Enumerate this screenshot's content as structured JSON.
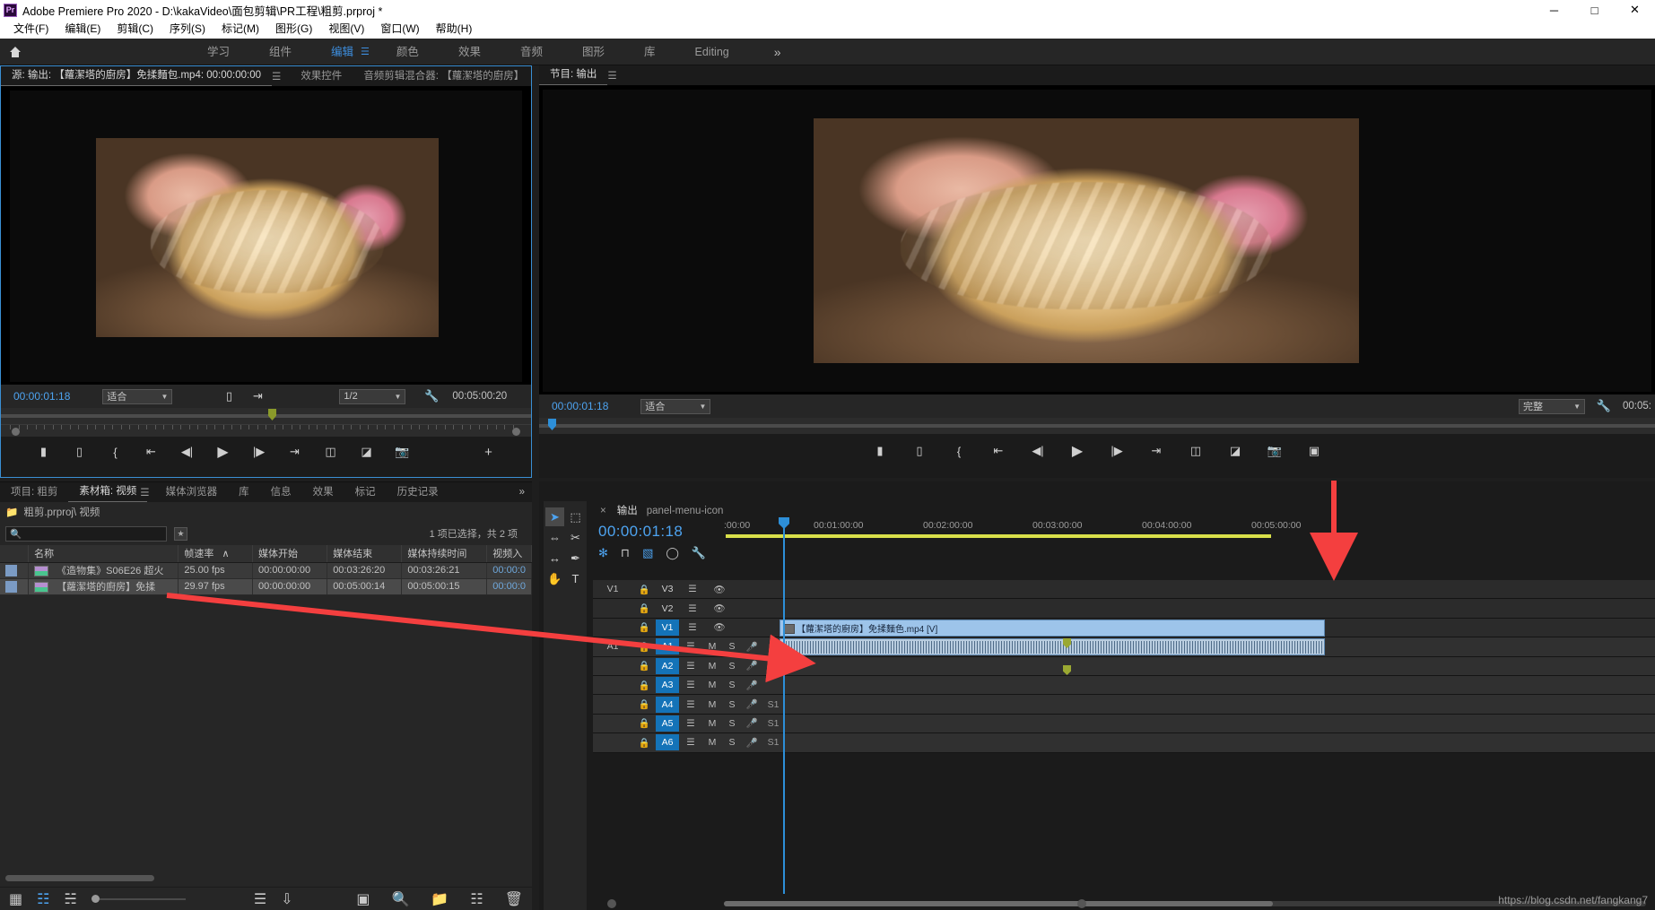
{
  "window": {
    "title": "Adobe Premiere Pro 2020 - D:\\kakaVideo\\面包剪辑\\PR工程\\粗剪.prproj *",
    "logo": "Pr",
    "minimize": "─",
    "maximize": "□",
    "close": "✕"
  },
  "menu": {
    "items": [
      "文件(F)",
      "编辑(E)",
      "剪辑(C)",
      "序列(S)",
      "标记(M)",
      "图形(G)",
      "视图(V)",
      "窗口(W)",
      "帮助(H)"
    ]
  },
  "workspace": {
    "home_icon": "home-icon",
    "tabs": [
      {
        "label": "学习",
        "active": false
      },
      {
        "label": "组件",
        "active": false
      },
      {
        "label": "编辑",
        "active": true
      },
      {
        "label": "颜色",
        "active": false
      },
      {
        "label": "效果",
        "active": false
      },
      {
        "label": "音频",
        "active": false
      },
      {
        "label": "图形",
        "active": false
      },
      {
        "label": "库",
        "active": false
      },
      {
        "label": "Editing",
        "active": false
      }
    ],
    "more": "»"
  },
  "source_monitor": {
    "tabs": [
      {
        "label": "源: 输出: 【蘿潔塔的廚房】免揉麵包.mp4: 00:00:00:00",
        "active": true
      },
      {
        "label": "效果控件",
        "active": false
      },
      {
        "label": "音频剪辑混合器: 【蘿潔塔的廚房】",
        "active": false
      }
    ],
    "overflow": "»",
    "timecode": "00:00:01:18",
    "fit": "适合",
    "resolution": "1/2",
    "duration": "00:05:00:20",
    "buttons": [
      "mark-in-icon",
      "mark-out-icon",
      "go-to-in-icon",
      "step-back-icon",
      "play-icon",
      "step-forward-icon",
      "go-to-out-icon",
      "insert-icon",
      "overwrite-icon",
      "export-frame-icon"
    ],
    "add_button": "+"
  },
  "program_monitor": {
    "tabs": [
      {
        "label": "节目: 输出",
        "active": true
      }
    ],
    "menu_icon": "panel-menu-icon",
    "timecode": "00:00:01:18",
    "fit": "适合",
    "quality": "完整",
    "duration": "00:05:",
    "buttons": [
      "mark-in-icon",
      "mark-out-icon",
      "go-to-in-icon",
      "step-back-icon",
      "play-icon",
      "step-forward-icon",
      "go-to-out-icon",
      "lift-icon",
      "extract-icon",
      "export-frame-icon",
      "comparison-view-icon"
    ]
  },
  "project_panel": {
    "tabs": [
      {
        "label": "项目: 粗剪",
        "active": false
      },
      {
        "label": "素材箱: 视频",
        "active": true
      },
      {
        "label": "媒体浏览器",
        "active": false
      },
      {
        "label": "库",
        "active": false
      },
      {
        "label": "信息",
        "active": false
      },
      {
        "label": "效果",
        "active": false
      },
      {
        "label": "标记",
        "active": false
      },
      {
        "label": "历史记录",
        "active": false
      }
    ],
    "overflow": "»",
    "breadcrumb": "粗剪.prproj\\ 视频",
    "search_placeholder": "",
    "search_icon": "search-icon",
    "selection_status": "1 项已选择，共 2 项",
    "columns": [
      "",
      "名称",
      "帧速率",
      "媒体开始",
      "媒体结束",
      "媒体持续时间",
      "视频入"
    ],
    "sort_indicator": "∧",
    "rows": [
      {
        "name": "《造物集》S06E26 超火",
        "frame_rate": "25.00 fps",
        "media_start": "00:00:00:00",
        "media_end": "00:03:26:20",
        "media_duration": "00:03:26:21",
        "video_in": "00:00:0",
        "selected": false
      },
      {
        "name": "【蘿潔塔的廚房】免揉",
        "frame_rate": "29.97 fps",
        "media_start": "00:00:00:00",
        "media_end": "00:05:00:14",
        "media_duration": "00:05:00:15",
        "video_in": "00:00:0",
        "selected": true
      }
    ],
    "footer_icons": [
      "list-view-icon",
      "icon-view-icon",
      "freeform-view-icon",
      "zoom-slider",
      "sort-icon",
      "automate-to-sequence-icon",
      "find-icon",
      "new-bin-icon",
      "new-item-icon",
      "delete-icon"
    ]
  },
  "timeline_panel": {
    "close_icon": "×",
    "title": "输出",
    "menu_icon": "panel-menu-icon",
    "timecode": "00:00:01:18",
    "toggle_icons": [
      "nest-icon",
      "snap-icon",
      "linked-selection-icon",
      "marker-icon",
      "timeline-settings-icon"
    ],
    "tools": [
      {
        "name": "selection-tool",
        "glyph": "➤",
        "active": true
      },
      {
        "name": "track-select-forward-tool",
        "glyph": "⬚",
        "active": false
      },
      {
        "name": "ripple-edit-tool",
        "glyph": "⇔",
        "active": false
      },
      {
        "name": "razor-tool",
        "glyph": "✂",
        "active": false
      },
      {
        "name": "slip-tool",
        "glyph": "↔",
        "active": false
      },
      {
        "name": "pen-tool",
        "glyph": "✒",
        "active": false
      },
      {
        "name": "hand-tool",
        "glyph": "✋",
        "active": false
      },
      {
        "name": "type-tool",
        "glyph": "T",
        "active": false
      }
    ],
    "ruler_labels": [
      ":00:00",
      "00:01:00:00",
      "00:02:00:00",
      "00:03:00:00",
      "00:04:00:00",
      "00:05:00:00"
    ],
    "video_tracks": [
      {
        "id": "V3",
        "source_patch": "V1",
        "targeted": false,
        "lock": "lock-icon",
        "sync": "sync-icon",
        "eye": "eye-icon"
      },
      {
        "id": "V2",
        "source_patch": "",
        "targeted": false,
        "lock": "lock-icon",
        "sync": "sync-icon",
        "eye": "eye-icon"
      },
      {
        "id": "V1",
        "source_patch": "",
        "targeted": true,
        "lock": "lock-icon",
        "sync": "sync-icon",
        "eye": "eye-icon"
      }
    ],
    "audio_tracks": [
      {
        "id": "A1",
        "source_patch": "A1",
        "targeted": true,
        "mute": "M",
        "solo": "S",
        "rec": "mic-icon",
        "extra": ""
      },
      {
        "id": "A2",
        "source_patch": "",
        "targeted": true,
        "mute": "M",
        "solo": "S",
        "rec": "mic-icon",
        "extra": ""
      },
      {
        "id": "A3",
        "source_patch": "",
        "targeted": true,
        "mute": "M",
        "solo": "S",
        "rec": "mic-icon",
        "extra": ""
      },
      {
        "id": "A4",
        "source_patch": "",
        "targeted": true,
        "mute": "M",
        "solo": "S",
        "rec": "mic-icon",
        "extra": "S1"
      },
      {
        "id": "A5",
        "source_patch": "",
        "targeted": true,
        "mute": "M",
        "solo": "S",
        "rec": "mic-icon",
        "extra": "S1"
      },
      {
        "id": "A6",
        "source_patch": "",
        "targeted": true,
        "mute": "M",
        "solo": "S",
        "rec": "mic-icon",
        "extra": "S1"
      }
    ],
    "clip_video_label": "【蘿潔塔的廚房】免揉麵色.mp4 [V]",
    "clip_audio_label": ""
  },
  "annotations": {
    "watermark": "https://blog.csdn.net/fangkang7",
    "arrow_color": "#f43f3f"
  },
  "colors": {
    "accent_blue": "#4da3f0",
    "panel_bg": "#262626",
    "dark_bg": "#1b1b1b",
    "track_target": "#1473b8",
    "clip_blue": "#9dc4ea",
    "annotation_red": "#f43f3f"
  }
}
